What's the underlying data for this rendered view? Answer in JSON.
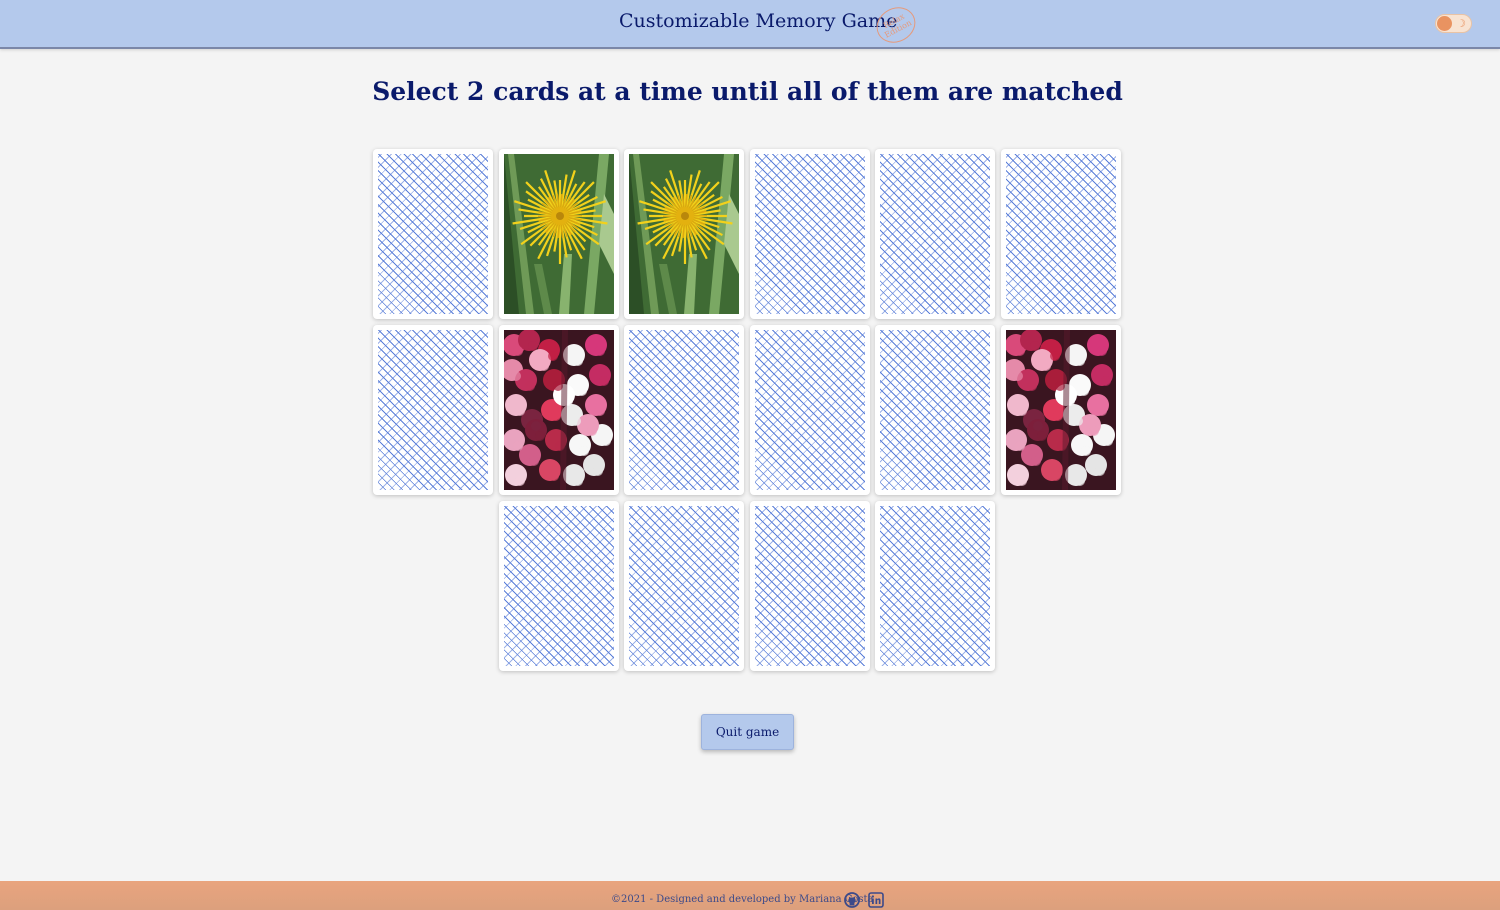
{
  "header": {
    "title": "Customizable Memory Game",
    "badge_line1": "Relax",
    "badge_line2": "Edition",
    "theme_toggle_icon": "moon-icon"
  },
  "main": {
    "instructions": "Select 2 cards at a time until all of them are matched",
    "cards": [
      {
        "state": "face-down"
      },
      {
        "state": "face-up",
        "image": "yellow-dandelion"
      },
      {
        "state": "face-up",
        "image": "yellow-dandelion"
      },
      {
        "state": "face-down"
      },
      {
        "state": "face-down"
      },
      {
        "state": "face-down"
      },
      {
        "state": "face-down"
      },
      {
        "state": "face-up",
        "image": "pink-red-flowers"
      },
      {
        "state": "face-down"
      },
      {
        "state": "face-down"
      },
      {
        "state": "face-down"
      },
      {
        "state": "face-up",
        "image": "pink-red-flowers"
      },
      {
        "state": "face-down"
      },
      {
        "state": "face-down"
      },
      {
        "state": "face-down"
      },
      {
        "state": "face-down"
      }
    ],
    "quit_label": "Quit game"
  },
  "footer": {
    "credits": "©2021 - Designed and developed by Mariana Costa",
    "icons": [
      "github-icon",
      "linkedin-icon"
    ]
  },
  "colors": {
    "header_bg": "#b4c9ec",
    "text_primary": "#0a1a6b",
    "footer_bg": "#e9a47e",
    "accent": "#e99361",
    "card_pattern": "#5b7fd9"
  }
}
